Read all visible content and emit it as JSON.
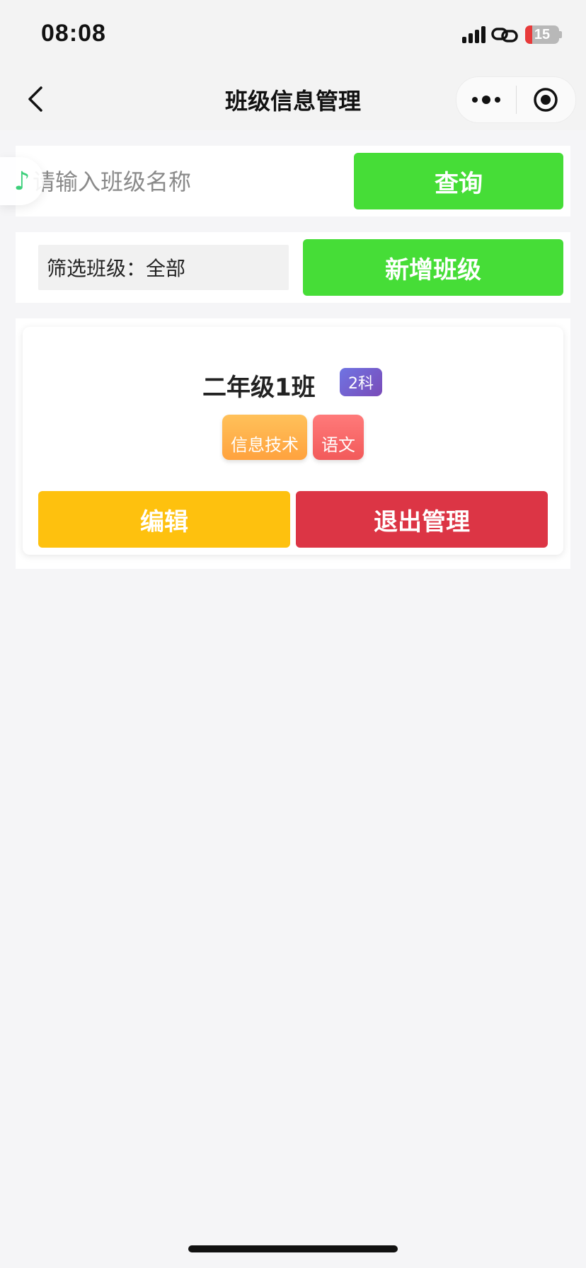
{
  "status_bar": {
    "time": "08:08",
    "battery": "15",
    "icons": [
      "signal-icon",
      "link-icon",
      "battery-icon"
    ]
  },
  "nav": {
    "title": "班级信息管理",
    "icons": [
      "back-icon",
      "more-icon",
      "record-icon"
    ]
  },
  "search": {
    "placeholder": "请输入班级名称",
    "button_label": "查询"
  },
  "floating": {
    "icon": "music-note-icon",
    "glyph": "♪"
  },
  "filter": {
    "label": "筛选班级：全部",
    "add_button_label": "新增班级"
  },
  "classes": [
    {
      "name": "二年级1班",
      "subject_count": "2科",
      "subjects": [
        "信息技术",
        "语文"
      ],
      "edit_label": "编辑",
      "exit_label": "退出管理"
    }
  ],
  "colors": {
    "accent_green": "#46dd37",
    "edit_yellow": "#fec10e",
    "exit_red": "#dc3545",
    "badge_purple": "#7a5fd0"
  }
}
